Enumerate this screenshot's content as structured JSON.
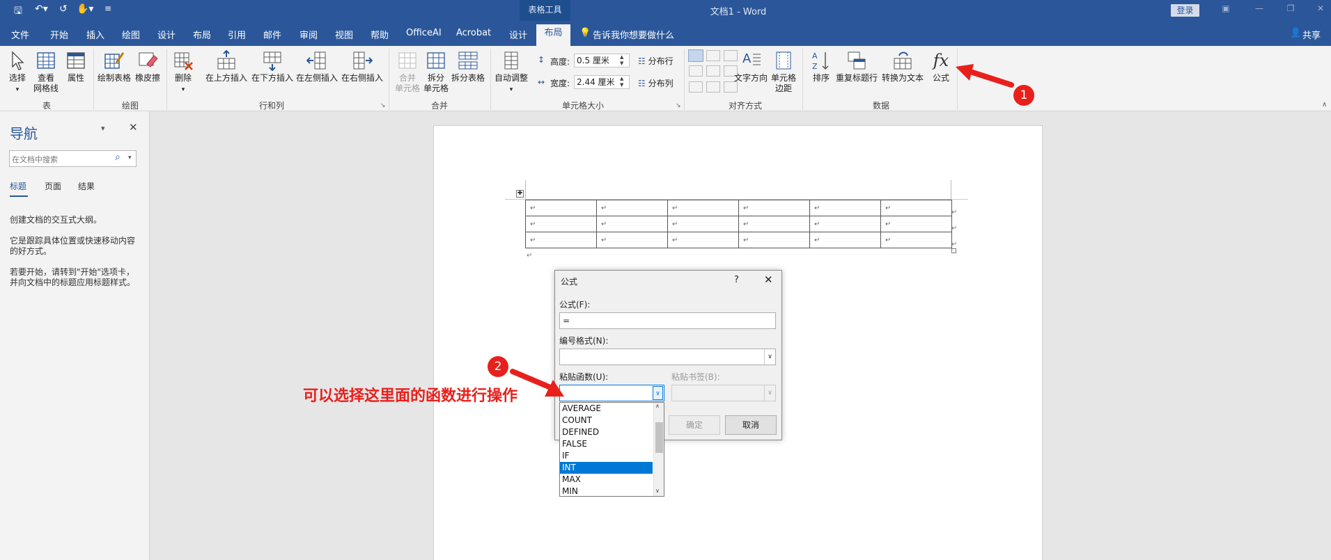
{
  "titlebar": {
    "contextual": "表格工具",
    "title": "文档1  -  Word",
    "login": "登录"
  },
  "tabs": {
    "file": "文件",
    "home": "开始",
    "insert": "插入",
    "draw": "绘图",
    "design": "设计",
    "layout_doc": "布局",
    "references": "引用",
    "mailings": "邮件",
    "review": "审阅",
    "view": "视图",
    "help": "帮助",
    "officeai": "OfficeAI",
    "acrobat": "Acrobat",
    "table_design": "设计",
    "table_layout": "布局",
    "tellme": "告诉我你想要做什么",
    "share": "共享"
  },
  "ribbon": {
    "select": "选择",
    "gridlines_1": "查看",
    "gridlines_2": "网格线",
    "properties": "属性",
    "group_table": "表",
    "draw_table": "绘制表格",
    "eraser": "橡皮擦",
    "group_draw": "绘图",
    "delete": "删除",
    "insert_above": "在上方插入",
    "insert_below": "在下方插入",
    "insert_left": "在左侧插入",
    "insert_right": "在右侧插入",
    "group_rowscols": "行和列",
    "merge_1": "合并",
    "merge_2": "单元格",
    "split_1": "拆分",
    "split_2": "单元格",
    "split_table": "拆分表格",
    "group_merge": "合并",
    "autofit": "自动调整",
    "height_label": "高度:",
    "height_value": "0.5 厘米",
    "width_label": "宽度:",
    "width_value": "2.44 厘米",
    "dist_rows": "分布行",
    "dist_cols": "分布列",
    "group_cellsize": "单元格大小",
    "text_direction": "文字方向",
    "cell_margins_1": "单元格",
    "cell_margins_2": "边距",
    "group_align": "对齐方式",
    "sort": "排序",
    "repeat_header": "重复标题行",
    "convert_text": "转换为文本",
    "formula": "公式",
    "group_data": "数据"
  },
  "navpane": {
    "title": "导航",
    "search_placeholder": "在文档中搜索",
    "tab_headings": "标题",
    "tab_pages": "页面",
    "tab_results": "结果",
    "text1": "创建文档的交互式大纲。",
    "text2a": "它是跟踪具体位置或快速移动内容",
    "text2b": "的好方式。",
    "text3a": "若要开始，请转到\"开始\"选项卡，",
    "text3b": "并向文档中的标题应用标题样式。"
  },
  "dialog": {
    "title": "公式",
    "help": "?",
    "formula_label": "公式(F):",
    "formula_value": "=",
    "number_format_label": "编号格式(N):",
    "paste_function_label": "粘贴函数(U):",
    "paste_bookmark_label": "粘贴书签(B):",
    "ok": "确定",
    "cancel": "取消",
    "functions": [
      "AVERAGE",
      "COUNT",
      "DEFINED",
      "FALSE",
      "IF",
      "INT",
      "MAX",
      "MIN"
    ],
    "selected_function": "INT"
  },
  "annotations": {
    "badge1": "1",
    "badge2": "2",
    "callout": "可以选择这里面的函数进行操作"
  },
  "table": {
    "rows": 3,
    "cols": 6,
    "cell_mark": "↵"
  },
  "colors": {
    "accent": "#2b579a",
    "annotation": "#e8201c",
    "selection": "#0078d7"
  }
}
